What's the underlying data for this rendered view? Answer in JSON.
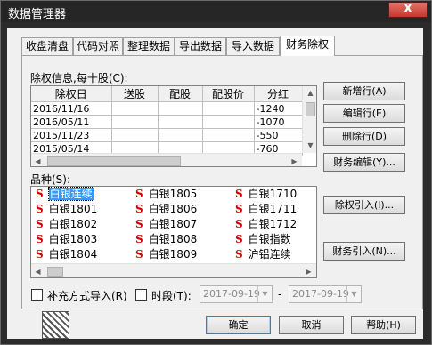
{
  "window": {
    "title": "数据管理器",
    "close_glyph": "X"
  },
  "tabs": [
    {
      "label": "收盘清盘"
    },
    {
      "label": "代码对照"
    },
    {
      "label": "整理数据"
    },
    {
      "label": "导出数据"
    },
    {
      "label": "导入数据"
    },
    {
      "label": "财务除权"
    }
  ],
  "active_tab": "财务除权",
  "dividend": {
    "label": "除权信息,每十股(C):",
    "columns": [
      "除权日",
      "送股",
      "配股",
      "配股价",
      "分红"
    ],
    "rows": [
      {
        "date": "2016/11/16",
        "song": "",
        "pei": "",
        "price": "",
        "div": "-1240"
      },
      {
        "date": "2016/05/11",
        "song": "",
        "pei": "",
        "price": "",
        "div": "-1070"
      },
      {
        "date": "2015/11/23",
        "song": "",
        "pei": "",
        "price": "",
        "div": "-550"
      },
      {
        "date": "2015/05/14",
        "song": "",
        "pei": "",
        "price": "",
        "div": "-760"
      }
    ]
  },
  "buttons": {
    "new_row": "新增行(A)",
    "edit_row": "编辑行(E)",
    "delete_row": "删除行(D)",
    "fin_edit": "财务编辑(Y)...",
    "exright_import": "除权引入(I)...",
    "fin_import": "财务引入(N)...",
    "ok": "确定",
    "cancel": "取消",
    "help": "帮助(H)"
  },
  "varieties": {
    "label": "品种(S):",
    "marker": "S",
    "selected": "白银连续",
    "columns": [
      [
        "白银连续",
        "白银1801",
        "白银1802",
        "白银1803",
        "白银1804"
      ],
      [
        "白银1805",
        "白银1806",
        "白银1807",
        "白银1808",
        "白银1809"
      ],
      [
        "白银1710",
        "白银1711",
        "白银1712",
        "白银指数",
        "沪铝连续"
      ]
    ]
  },
  "options": {
    "supplement_label": "补充方式导入(R)",
    "period_label": "时段(T):",
    "date_from": "2017-09-19",
    "date_to": "2017-09-19",
    "separator": "-"
  },
  "colors": {
    "selection": "#3399ff",
    "marker": "#d40000",
    "title_bar": "#262626"
  }
}
